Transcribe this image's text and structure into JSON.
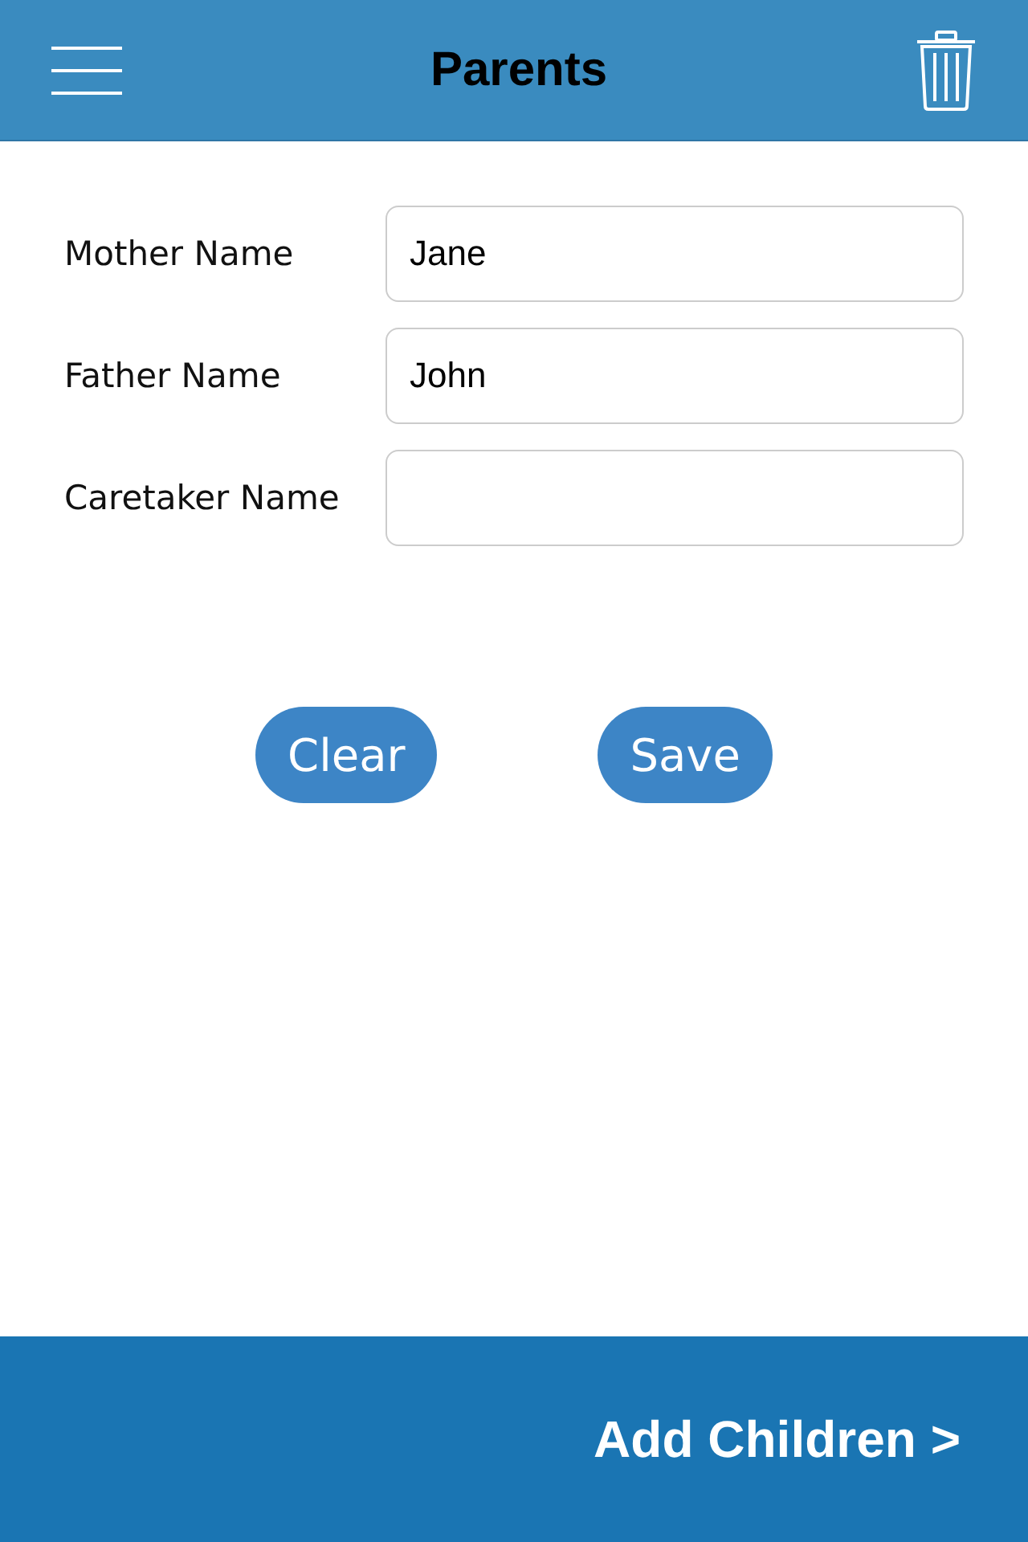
{
  "header": {
    "title": "Parents"
  },
  "fields": [
    {
      "label": "Mother Name",
      "value": "Jane"
    },
    {
      "label": "Father Name",
      "value": "John"
    },
    {
      "label": "Caretaker Name"
    }
  ],
  "buttons": [
    "Clear",
    "Save"
  ],
  "footer": {
    "link": "Add Children >"
  }
}
